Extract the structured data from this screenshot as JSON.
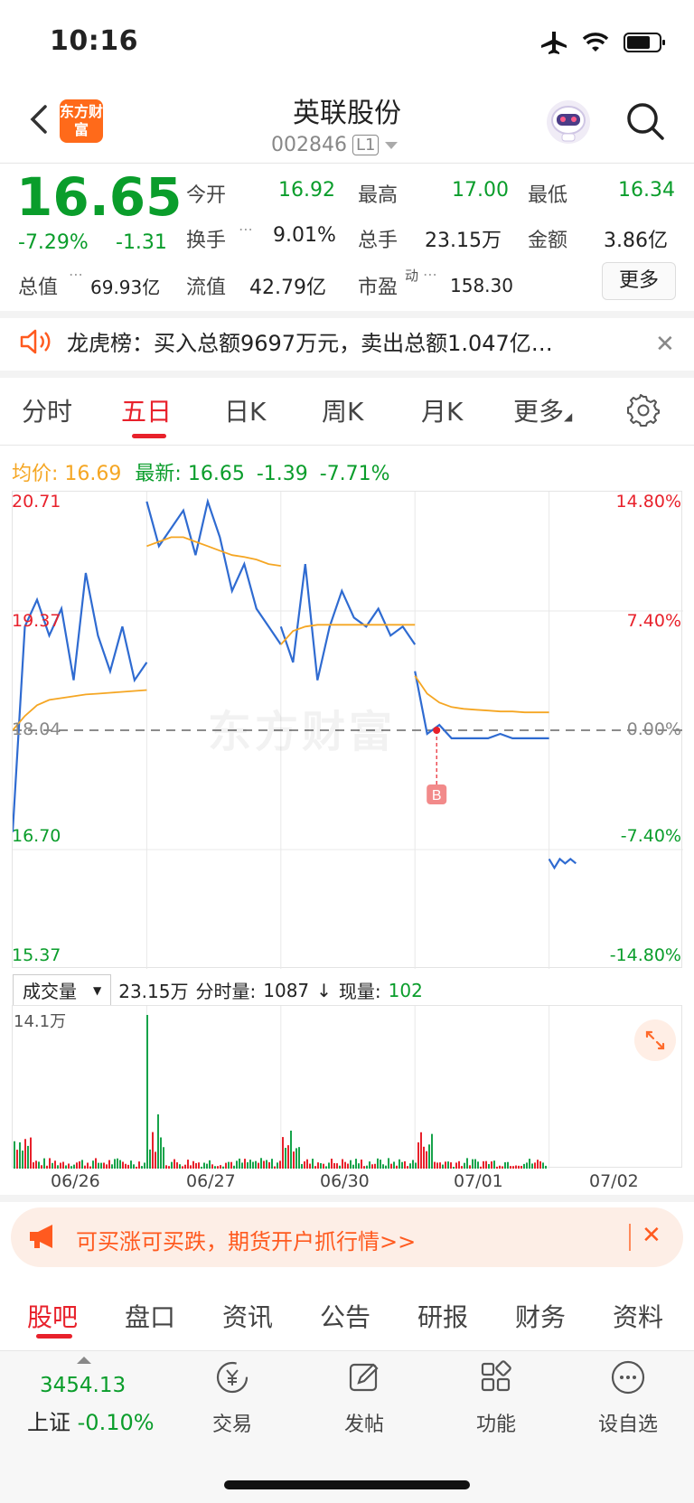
{
  "status_bar": {
    "time": "10:16"
  },
  "header": {
    "logo_text": "东方财富",
    "stock_name": "英联股份",
    "stock_code": "002846",
    "level_badge": "L1"
  },
  "quote": {
    "price": "16.65",
    "change_pct": "-7.29%",
    "change": "-1.31",
    "rows": [
      [
        {
          "label": "今开",
          "value": "16.92",
          "color": "green"
        },
        {
          "label": "最高",
          "value": "17.00",
          "color": "green"
        },
        {
          "label": "最低",
          "value": "16.34",
          "color": "green"
        }
      ],
      [
        {
          "label": "换手",
          "value": "9.01%",
          "color": "black"
        },
        {
          "label": "总手",
          "value": "23.15万",
          "color": "black"
        },
        {
          "label": "金额",
          "value": "3.86亿",
          "color": "black"
        }
      ]
    ],
    "market_value_label": "总值",
    "market_value": "69.93亿",
    "float_value_label": "流值",
    "float_value": "42.79亿",
    "pe_label": "市盈",
    "pe_sup": "动",
    "pe_value": "158.30",
    "more_label": "更多"
  },
  "notice": {
    "text": "龙虎榜：买入总额9697万元，卖出总额1.047亿…"
  },
  "chart_tabs": {
    "items": [
      "分时",
      "五日",
      "日K",
      "周K",
      "月K",
      "更多"
    ],
    "active": "五日"
  },
  "chart_header": {
    "avg_label": "均价:",
    "avg_value": "16.69",
    "latest_label": "最新:",
    "latest_value": "16.65",
    "change": "-1.39",
    "change_pct": "-7.71%"
  },
  "chart_data": {
    "type": "line",
    "title": "",
    "y_left_ticks": [
      "20.71",
      "19.37",
      "18.04",
      "16.70",
      "15.37"
    ],
    "y_right_ticks": [
      "14.80%",
      "7.40%",
      "0.00%",
      "-7.40%",
      "-14.80%"
    ],
    "ylim": [
      15.37,
      20.71
    ],
    "baseline": 18.04,
    "x_dates": [
      "06/26",
      "06/27",
      "06/30",
      "07/01",
      "07/02"
    ],
    "series": [
      {
        "name": "",
        "color": "#2f6bd1",
        "days": [
          [
            16.9,
            19.2,
            19.5,
            19.1,
            19.4,
            18.6,
            19.8,
            19.1,
            18.7,
            19.2,
            18.6,
            18.8
          ],
          [
            20.6,
            20.1,
            20.3,
            20.5,
            20.0,
            20.6,
            20.2,
            19.6,
            19.9,
            19.4,
            19.2,
            19.0
          ],
          [
            19.2,
            18.8,
            19.9,
            18.6,
            19.2,
            19.6,
            19.3,
            19.2,
            19.4,
            19.1,
            19.2,
            19.0
          ],
          [
            18.7,
            18.0,
            18.1,
            17.95,
            17.95,
            17.95,
            17.95,
            18.0,
            17.95,
            17.95,
            17.95,
            17.95
          ],
          [
            16.6,
            16.5,
            16.6,
            16.55,
            16.6,
            16.55
          ]
        ]
      },
      {
        "name": "",
        "color": "#f5a623",
        "days": [
          [
            18.04,
            18.2,
            18.32,
            18.38,
            18.4,
            18.42,
            18.44,
            18.45,
            18.46,
            18.47,
            18.48,
            18.49
          ],
          [
            20.1,
            20.15,
            20.2,
            20.2,
            20.15,
            20.1,
            20.05,
            20.0,
            19.98,
            19.95,
            19.9,
            19.88
          ],
          [
            19.0,
            19.15,
            19.2,
            19.22,
            19.22,
            19.22,
            19.22,
            19.22,
            19.22,
            19.22,
            19.22,
            19.22
          ],
          [
            18.65,
            18.45,
            18.35,
            18.3,
            18.28,
            18.27,
            18.26,
            18.25,
            18.25,
            18.24,
            18.24,
            18.24
          ],
          []
        ]
      }
    ],
    "marker": {
      "label": "B",
      "day": 3
    }
  },
  "volume": {
    "selector_label": "成交量",
    "total": "23.15万",
    "minute_label": "分时量:",
    "minute_value": "1087",
    "now_label": "现量:",
    "now_value": "102",
    "max_label": "14.1万"
  },
  "ad": {
    "text": "可买涨可买跌，期货开户抓行情>>"
  },
  "bottom_tabs": {
    "items": [
      "股吧",
      "盘口",
      "资讯",
      "公告",
      "研报",
      "财务",
      "资料"
    ],
    "active": "股吧"
  },
  "footer": {
    "index_value": "3454.13",
    "index_name": "上证",
    "index_change": "-0.10%",
    "items": [
      {
        "label": "交易",
        "icon": "yen-exchange-icon"
      },
      {
        "label": "发帖",
        "icon": "edit-icon"
      },
      {
        "label": "功能",
        "icon": "grid-icon"
      },
      {
        "label": "设自选",
        "icon": "more-circle-icon"
      }
    ]
  }
}
